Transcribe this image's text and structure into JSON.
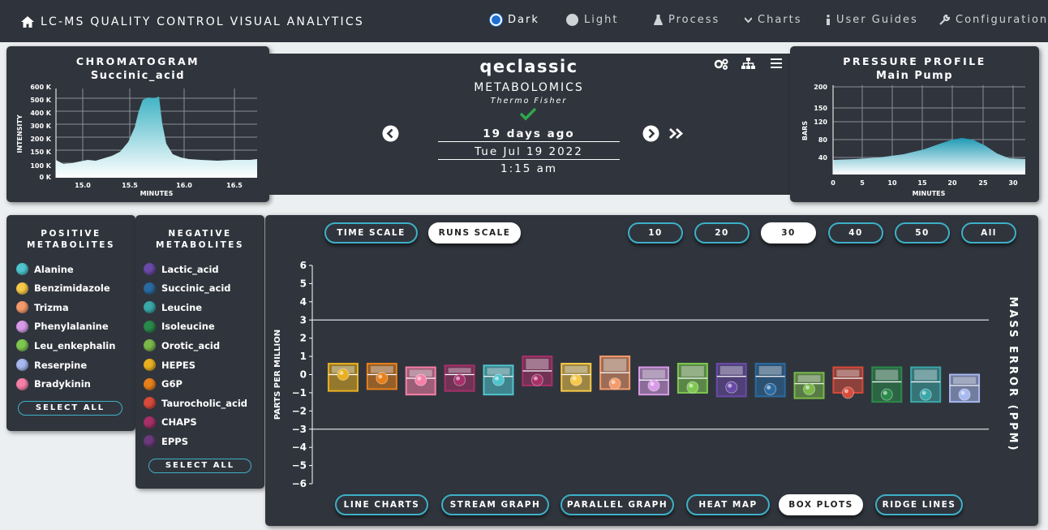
{
  "nav": {
    "title": "LC-MS QUALITY CONTROL VISUAL ANALYTICS",
    "dark_label": "Dark",
    "light_label": "Light",
    "process_label": "Process",
    "charts_label": "Charts",
    "guides_label": "User Guides",
    "config_label": "Configuration"
  },
  "chromatogram": {
    "title": "CHROMATOGRAM",
    "compound": "Succinic_acid",
    "ylabel": "INTENSITY",
    "xlabel": "MINUTES",
    "yticks": [
      "0 K",
      "100 K",
      "150 K",
      "200 K",
      "300 K",
      "400 K",
      "500 K",
      "600 K"
    ],
    "xticks": [
      "15.0",
      "15.5",
      "16.0",
      "16.5"
    ]
  },
  "run": {
    "name": "qeclassic",
    "type": "METABOLOMICS",
    "vendor": "Thermo Fisher",
    "ago": "19 days ago",
    "date": "Tue Jul 19 2022",
    "time": "1:15 am"
  },
  "pressure": {
    "title": "PRESSURE PROFILE",
    "subtitle": "Main Pump",
    "ylabel": "BARS",
    "xlabel": "MINUTES",
    "yticks": [
      "200",
      "150",
      "120",
      "80",
      "40"
    ],
    "xticks": [
      "0",
      "5",
      "10",
      "15",
      "20",
      "25",
      "30"
    ]
  },
  "positive": {
    "title_line1": "POSITIVE",
    "title_line2": "METABOLITES",
    "select_all": "SELECT ALL",
    "items": [
      {
        "label": "Alanine",
        "color": "#4fc4cf"
      },
      {
        "label": "Benzimidazole",
        "color": "#f7c948"
      },
      {
        "label": "Trizma",
        "color": "#f59a6b"
      },
      {
        "label": "Phenylalanine",
        "color": "#d89ae8"
      },
      {
        "label": "Leu_enkephalin",
        "color": "#7ec850"
      },
      {
        "label": "Reserpine",
        "color": "#a8b8f0"
      },
      {
        "label": "Bradykinin",
        "color": "#f77fa8"
      }
    ]
  },
  "negative": {
    "title_line1": "NEGATIVE",
    "title_line2": "METABOLITES",
    "select_all": "SELECT ALL",
    "items": [
      {
        "label": "Lactic_acid",
        "color": "#6a4aa8"
      },
      {
        "label": "Succinic_acid",
        "color": "#2a6aa0"
      },
      {
        "label": "Leucine",
        "color": "#3aa8a8"
      },
      {
        "label": "Isoleucine",
        "color": "#2a8a4a"
      },
      {
        "label": "Orotic_acid",
        "color": "#7ab84a"
      },
      {
        "label": "HEPES",
        "color": "#e8b020"
      },
      {
        "label": "G6P",
        "color": "#e8801a"
      },
      {
        "label": "Taurocholic_acid",
        "color": "#d84a3a"
      },
      {
        "label": "CHAPS",
        "color": "#a8306a"
      },
      {
        "label": "EPPS",
        "color": "#6a3a7a"
      }
    ]
  },
  "scale": {
    "time": "TIME SCALE",
    "runs": "RUNS SCALE"
  },
  "counts": [
    "10",
    "20",
    "30",
    "40",
    "50",
    "All"
  ],
  "views": [
    "LINE CHARTS",
    "STREAM GRAPH",
    "PARALLEL GRAPH",
    "HEAT MAP",
    "BOX PLOTS",
    "RIDGE LINES"
  ],
  "chart_data": {
    "type": "box",
    "ylabel": "PARTS PER MILLION",
    "y2label": "MASS ERROR (PPM)",
    "ylim": [
      -6,
      6
    ],
    "threshold_lines": [
      3,
      -3
    ],
    "boxes": [
      {
        "color": "#e8b020",
        "q1": -0.9,
        "median": 0,
        "q3": 0.6,
        "point": 0
      },
      {
        "color": "#e8801a",
        "q1": -0.8,
        "median": 0,
        "q3": 0.6,
        "point": -0.2
      },
      {
        "color": "#f77fa8",
        "q1": -1.1,
        "median": -0.2,
        "q3": 0.4,
        "point": -0.3
      },
      {
        "color": "#a8306a",
        "q1": -0.9,
        "median": 0,
        "q3": 0.5,
        "point": -0.3
      },
      {
        "color": "#4fc4cf",
        "q1": -1.1,
        "median": -0.1,
        "q3": 0.5,
        "point": -0.3
      },
      {
        "color": "#a8306a",
        "q1": -0.6,
        "median": 0.2,
        "q3": 1.0,
        "point": -0.3
      },
      {
        "color": "#f7c948",
        "q1": -0.9,
        "median": 0,
        "q3": 0.6,
        "point": -0.3
      },
      {
        "color": "#f59a6b",
        "q1": -0.8,
        "median": 0.1,
        "q3": 1.0,
        "point": -0.5
      },
      {
        "color": "#d89ae8",
        "q1": -1.1,
        "median": -0.3,
        "q3": 0.4,
        "point": -0.6
      },
      {
        "color": "#7ec850",
        "q1": -1.0,
        "median": -0.2,
        "q3": 0.6,
        "point": -0.7
      },
      {
        "color": "#6a4aa8",
        "q1": -1.2,
        "median": -0.1,
        "q3": 0.6,
        "point": -0.7
      },
      {
        "color": "#2a6aa0",
        "q1": -1.2,
        "median": -0.1,
        "q3": 0.6,
        "point": -0.8
      },
      {
        "color": "#7ab84a",
        "q1": -1.3,
        "median": -0.5,
        "q3": 0.1,
        "point": -0.8
      },
      {
        "color": "#d84a3a",
        "q1": -1.0,
        "median": -0.2,
        "q3": 0.4,
        "point": -1.0
      },
      {
        "color": "#2a8a4a",
        "q1": -1.5,
        "median": -0.4,
        "q3": 0.4,
        "point": -1.1
      },
      {
        "color": "#3aa8a8",
        "q1": -1.5,
        "median": -0.4,
        "q3": 0.4,
        "point": -1.1
      },
      {
        "color": "#a8b8f0",
        "q1": -1.5,
        "median": -0.6,
        "q3": 0,
        "point": -1.1
      }
    ]
  }
}
